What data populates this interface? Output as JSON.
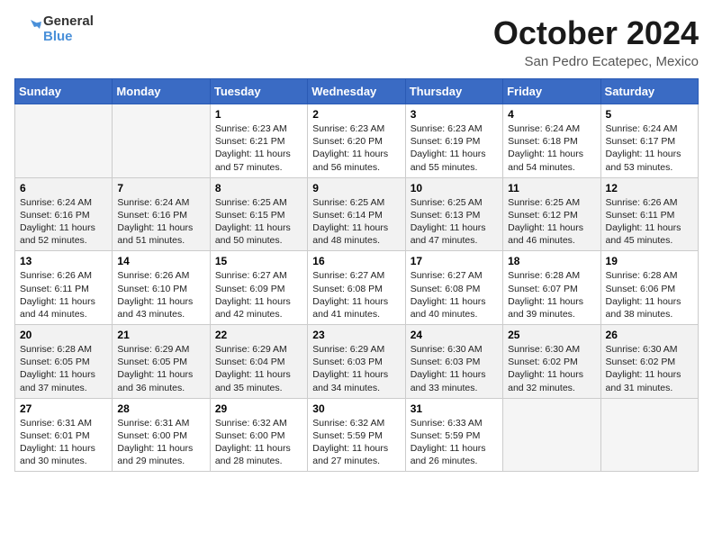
{
  "header": {
    "logo_line1": "General",
    "logo_line2": "Blue",
    "month": "October 2024",
    "location": "San Pedro Ecatepec, Mexico"
  },
  "days_of_week": [
    "Sunday",
    "Monday",
    "Tuesday",
    "Wednesday",
    "Thursday",
    "Friday",
    "Saturday"
  ],
  "weeks": [
    [
      {
        "day": "",
        "info": ""
      },
      {
        "day": "",
        "info": ""
      },
      {
        "day": "1",
        "info": "Sunrise: 6:23 AM\nSunset: 6:21 PM\nDaylight: 11 hours and 57 minutes."
      },
      {
        "day": "2",
        "info": "Sunrise: 6:23 AM\nSunset: 6:20 PM\nDaylight: 11 hours and 56 minutes."
      },
      {
        "day": "3",
        "info": "Sunrise: 6:23 AM\nSunset: 6:19 PM\nDaylight: 11 hours and 55 minutes."
      },
      {
        "day": "4",
        "info": "Sunrise: 6:24 AM\nSunset: 6:18 PM\nDaylight: 11 hours and 54 minutes."
      },
      {
        "day": "5",
        "info": "Sunrise: 6:24 AM\nSunset: 6:17 PM\nDaylight: 11 hours and 53 minutes."
      }
    ],
    [
      {
        "day": "6",
        "info": "Sunrise: 6:24 AM\nSunset: 6:16 PM\nDaylight: 11 hours and 52 minutes."
      },
      {
        "day": "7",
        "info": "Sunrise: 6:24 AM\nSunset: 6:16 PM\nDaylight: 11 hours and 51 minutes."
      },
      {
        "day": "8",
        "info": "Sunrise: 6:25 AM\nSunset: 6:15 PM\nDaylight: 11 hours and 50 minutes."
      },
      {
        "day": "9",
        "info": "Sunrise: 6:25 AM\nSunset: 6:14 PM\nDaylight: 11 hours and 48 minutes."
      },
      {
        "day": "10",
        "info": "Sunrise: 6:25 AM\nSunset: 6:13 PM\nDaylight: 11 hours and 47 minutes."
      },
      {
        "day": "11",
        "info": "Sunrise: 6:25 AM\nSunset: 6:12 PM\nDaylight: 11 hours and 46 minutes."
      },
      {
        "day": "12",
        "info": "Sunrise: 6:26 AM\nSunset: 6:11 PM\nDaylight: 11 hours and 45 minutes."
      }
    ],
    [
      {
        "day": "13",
        "info": "Sunrise: 6:26 AM\nSunset: 6:11 PM\nDaylight: 11 hours and 44 minutes."
      },
      {
        "day": "14",
        "info": "Sunrise: 6:26 AM\nSunset: 6:10 PM\nDaylight: 11 hours and 43 minutes."
      },
      {
        "day": "15",
        "info": "Sunrise: 6:27 AM\nSunset: 6:09 PM\nDaylight: 11 hours and 42 minutes."
      },
      {
        "day": "16",
        "info": "Sunrise: 6:27 AM\nSunset: 6:08 PM\nDaylight: 11 hours and 41 minutes."
      },
      {
        "day": "17",
        "info": "Sunrise: 6:27 AM\nSunset: 6:08 PM\nDaylight: 11 hours and 40 minutes."
      },
      {
        "day": "18",
        "info": "Sunrise: 6:28 AM\nSunset: 6:07 PM\nDaylight: 11 hours and 39 minutes."
      },
      {
        "day": "19",
        "info": "Sunrise: 6:28 AM\nSunset: 6:06 PM\nDaylight: 11 hours and 38 minutes."
      }
    ],
    [
      {
        "day": "20",
        "info": "Sunrise: 6:28 AM\nSunset: 6:05 PM\nDaylight: 11 hours and 37 minutes."
      },
      {
        "day": "21",
        "info": "Sunrise: 6:29 AM\nSunset: 6:05 PM\nDaylight: 11 hours and 36 minutes."
      },
      {
        "day": "22",
        "info": "Sunrise: 6:29 AM\nSunset: 6:04 PM\nDaylight: 11 hours and 35 minutes."
      },
      {
        "day": "23",
        "info": "Sunrise: 6:29 AM\nSunset: 6:03 PM\nDaylight: 11 hours and 34 minutes."
      },
      {
        "day": "24",
        "info": "Sunrise: 6:30 AM\nSunset: 6:03 PM\nDaylight: 11 hours and 33 minutes."
      },
      {
        "day": "25",
        "info": "Sunrise: 6:30 AM\nSunset: 6:02 PM\nDaylight: 11 hours and 32 minutes."
      },
      {
        "day": "26",
        "info": "Sunrise: 6:30 AM\nSunset: 6:02 PM\nDaylight: 11 hours and 31 minutes."
      }
    ],
    [
      {
        "day": "27",
        "info": "Sunrise: 6:31 AM\nSunset: 6:01 PM\nDaylight: 11 hours and 30 minutes."
      },
      {
        "day": "28",
        "info": "Sunrise: 6:31 AM\nSunset: 6:00 PM\nDaylight: 11 hours and 29 minutes."
      },
      {
        "day": "29",
        "info": "Sunrise: 6:32 AM\nSunset: 6:00 PM\nDaylight: 11 hours and 28 minutes."
      },
      {
        "day": "30",
        "info": "Sunrise: 6:32 AM\nSunset: 5:59 PM\nDaylight: 11 hours and 27 minutes."
      },
      {
        "day": "31",
        "info": "Sunrise: 6:33 AM\nSunset: 5:59 PM\nDaylight: 11 hours and 26 minutes."
      },
      {
        "day": "",
        "info": ""
      },
      {
        "day": "",
        "info": ""
      }
    ]
  ]
}
